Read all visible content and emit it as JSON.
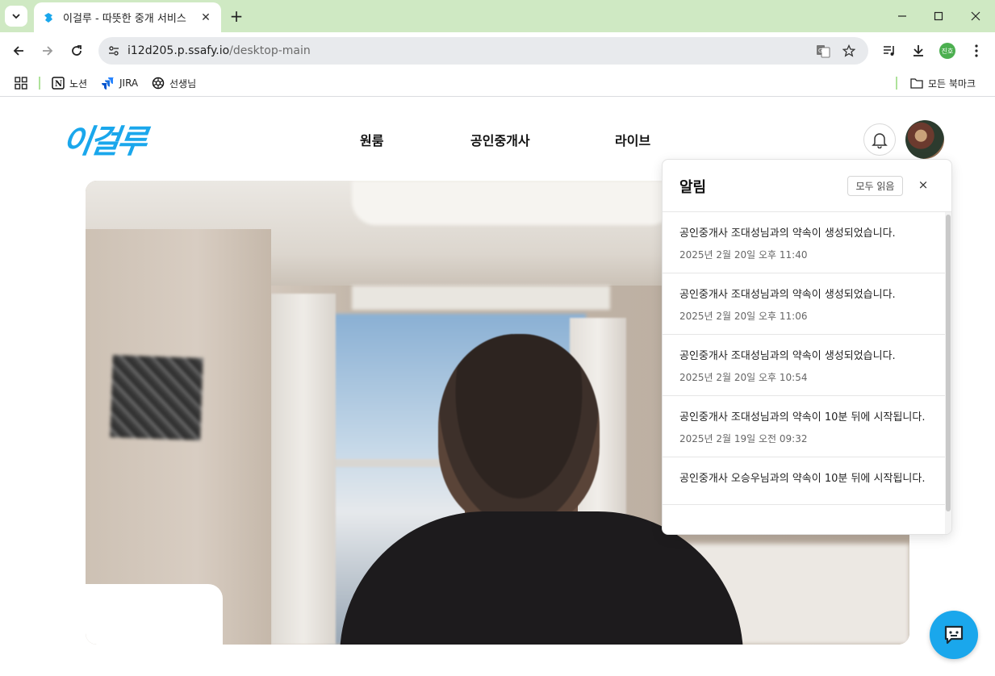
{
  "browser": {
    "tab_title": "이걸루 - 따뜻한 중개 서비스",
    "url_host": "i12d205.p.ssafy.io",
    "url_path": "/desktop-main",
    "profile_initials": "진호",
    "bookmarks": [
      {
        "label": "노션",
        "icon": "notion-icon"
      },
      {
        "label": "JIRA",
        "icon": "jira-icon"
      },
      {
        "label": "선생님",
        "icon": "openai-icon"
      }
    ],
    "all_bookmarks": "모든 북마크"
  },
  "site": {
    "logo_text": "이걸루",
    "nav": [
      "원룸",
      "공인중개사",
      "라이브"
    ],
    "accent_color": "#1aa7ec"
  },
  "notifications": {
    "title": "알림",
    "mark_all_read": "모두 읽음",
    "close_symbol": "×",
    "items": [
      {
        "message": "공인중개사 조대성님과의 약속이 생성되었습니다.",
        "time": "2025년 2월 20일 오후 11:40"
      },
      {
        "message": "공인중개사 조대성님과의 약속이 생성되었습니다.",
        "time": "2025년 2월 20일 오후 11:06"
      },
      {
        "message": "공인중개사 조대성님과의 약속이 생성되었습니다.",
        "time": "2025년 2월 20일 오후 10:54"
      },
      {
        "message": "공인중개사 조대성님과의 약속이 10분 뒤에 시작됩니다.",
        "time": "2025년 2월 19일 오전 09:32"
      },
      {
        "message": "공인중개사 오승우님과의 약속이 10분 뒤에 시작됩니다.",
        "time": ""
      }
    ]
  }
}
